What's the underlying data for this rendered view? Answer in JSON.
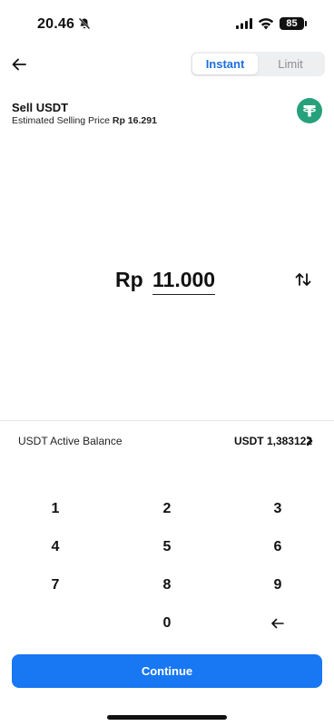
{
  "status_bar": {
    "time": "20.46",
    "battery": "85"
  },
  "header": {
    "tabs": [
      {
        "label": "Instant",
        "active": true
      },
      {
        "label": "Limit",
        "active": false
      }
    ]
  },
  "asset": {
    "title": "Sell USDT",
    "price_label": "Estimated Selling Price",
    "price_value": "Rp 16.291",
    "icon": "tether-icon",
    "brand_color": "#26a17b"
  },
  "amount": {
    "currency": "Rp",
    "value": "11.000"
  },
  "balance": {
    "label": "USDT Active Balance",
    "value": "USDT 1,383122"
  },
  "keypad": {
    "keys": [
      "1",
      "2",
      "3",
      "4",
      "5",
      "6",
      "7",
      "8",
      "9",
      "0"
    ],
    "backspace_icon": "backspace-arrow-icon"
  },
  "continue_label": "Continue",
  "colors": {
    "accent": "#1877f2",
    "tab_active": "#1d6fe0"
  }
}
